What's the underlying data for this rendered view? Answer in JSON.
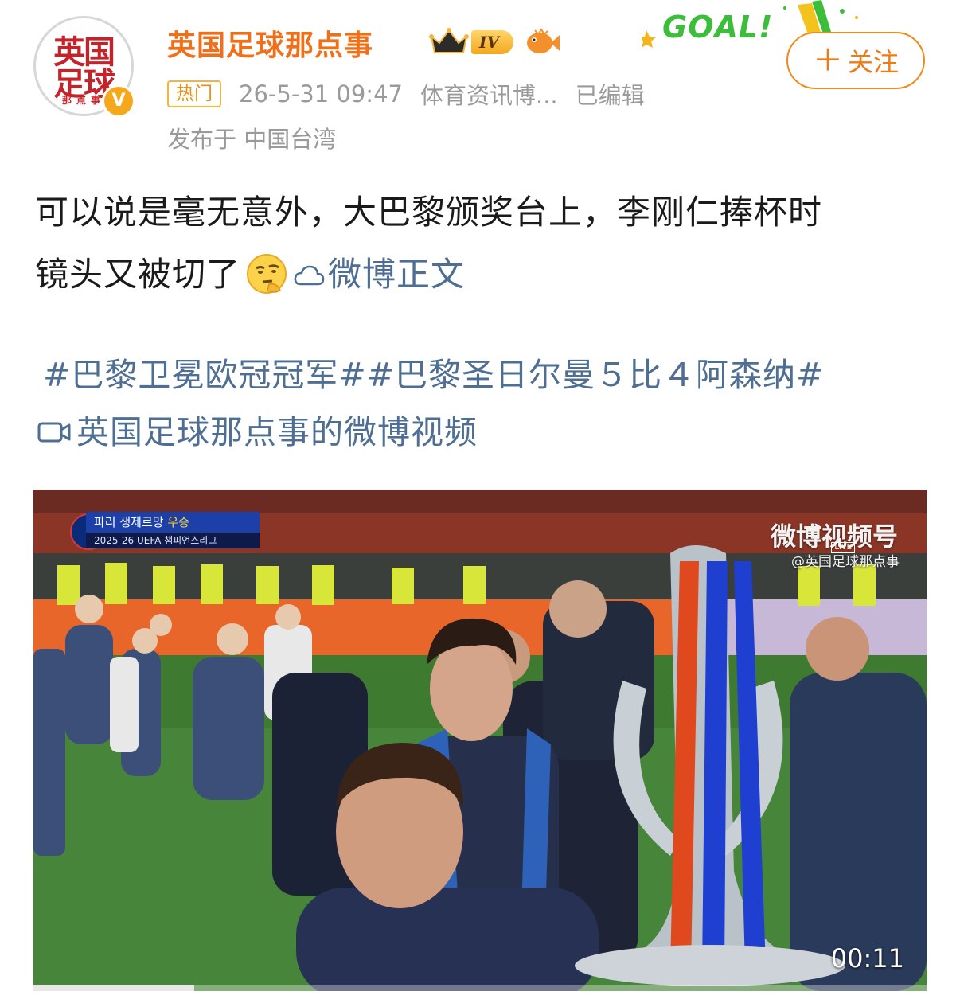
{
  "header": {
    "avatar_text_line1": "英国",
    "avatar_text_line2": "足球",
    "avatar_text_line3": "那点事",
    "verified_badge": "V",
    "username": "英国足球那点事",
    "level_badge": "IV",
    "hot_tag": "热门",
    "timestamp": "26-5-31 09:47",
    "source": "体育资讯博...",
    "edited": "已编辑",
    "location": "发布于 中国台湾",
    "goal_banner": "GOAL!",
    "follow_label": "关注",
    "follow_plus": "＋"
  },
  "post": {
    "text_line1": "可以说是毫无意外，大巴黎颁奖台上，李刚仁捧杯时",
    "text_line2": "镜头又被切了",
    "full_text_link": "微博正文",
    "topics": "#巴黎卫冕欧冠冠军##巴黎圣日尔曼５比４阿森纳#",
    "video_link": "英国足球那点事的微博视频"
  },
  "video": {
    "scoreboard_team": "파리 생제르망",
    "scoreboard_status": "우승",
    "scoreboard_competition": "2025-26 UEFA 챔피언스리그",
    "watermark_main": "微博视频号",
    "watermark_sub": "@英国足球那点事",
    "watermark_live": "LIVE",
    "duration": "00:11",
    "progress": 0.18
  },
  "colors": {
    "accent_orange": "#f26f19",
    "link_blue": "#4e6f93",
    "meta_gray": "#9a9a9a"
  }
}
